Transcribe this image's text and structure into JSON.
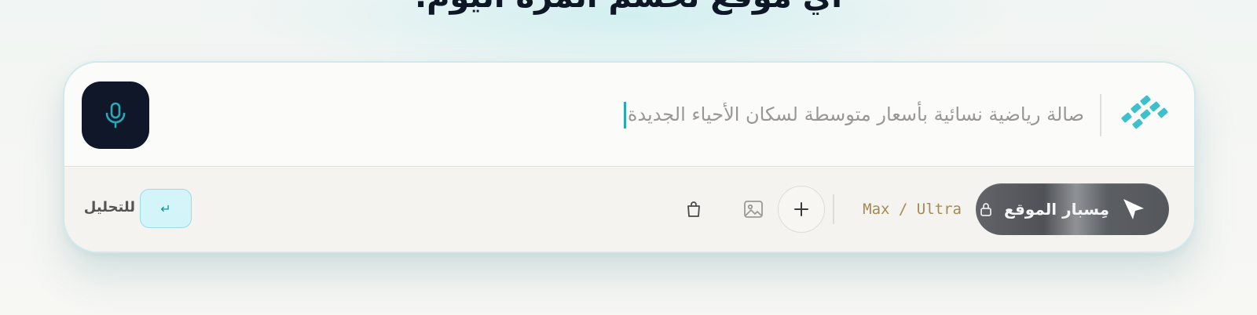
{
  "headline": "أي موقع تحسم المرة اليوم.",
  "composer": {
    "prompt_text": "صالة رياضية نسائية بأسعار متوسطة لسكان الأحياء الجديدة",
    "mic_icon": "microphone-icon",
    "logo_icon": "brand-logo-mark"
  },
  "toolbar": {
    "mode_label": "مِسبار الموقع",
    "mode_icons": [
      "send-arrow-icon",
      "lock-icon"
    ],
    "tier_label": "Max / Ultra",
    "add_icon": "plus-icon",
    "image_icon": "image-icon",
    "bag_icon": "shopping-bag-icon",
    "enter_key_symbol": "↵",
    "enter_hint": "للتحليل"
  },
  "colors": {
    "accent_teal": "#27aab8",
    "dark_navy": "#0f1729",
    "tier_gold": "#a58a53",
    "pill_gray": "#56595e",
    "enter_key_bg": "#d3f5fa"
  }
}
